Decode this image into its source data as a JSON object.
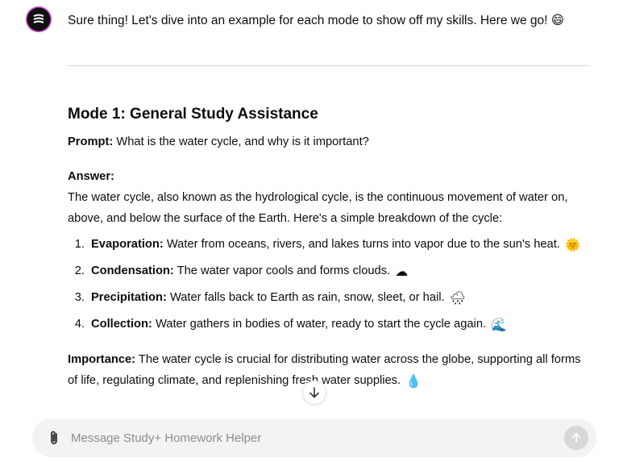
{
  "message": {
    "intro": "Sure thing! Let's dive into an example for each mode to show off my skills. Here we go! 😄",
    "heading": "Mode 1: General Study Assistance",
    "prompt_label": "Prompt:",
    "prompt_text": " What is the water cycle, and why is it important?",
    "answer_label": "Answer:",
    "answer_text": "The water cycle, also known as the hydrological cycle, is the continuous movement of water on, above, and below the surface of the Earth. Here's a simple breakdown of the cycle:",
    "steps": [
      {
        "num": "1.",
        "term": "Evaporation:",
        "text": " Water from oceans, rivers, and lakes turns into vapor due to the sun's heat.",
        "emoji": "🌞"
      },
      {
        "num": "2.",
        "term": "Condensation:",
        "text": " The water vapor cools and forms clouds.",
        "emoji": "☁"
      },
      {
        "num": "3.",
        "term": "Precipitation:",
        "text": " Water falls back to Earth as rain, snow, sleet, or hail.",
        "emoji": "🌧"
      },
      {
        "num": "4.",
        "term": "Collection:",
        "text": " Water gathers in bodies of water, ready to start the cycle again.",
        "emoji": "🌊"
      }
    ],
    "importance_label": "Importance:",
    "importance_text": " The water cycle is crucial for distributing water across the globe, supporting all forms of life, regulating climate, and replenishing fresh water supplies.",
    "importance_emoji": "💧"
  },
  "composer": {
    "placeholder": "Message Study+ Homework Helper",
    "attach_icon": "paperclip-icon",
    "send_icon": "arrow-up-icon"
  },
  "scroll_icon": "arrow-down-icon"
}
